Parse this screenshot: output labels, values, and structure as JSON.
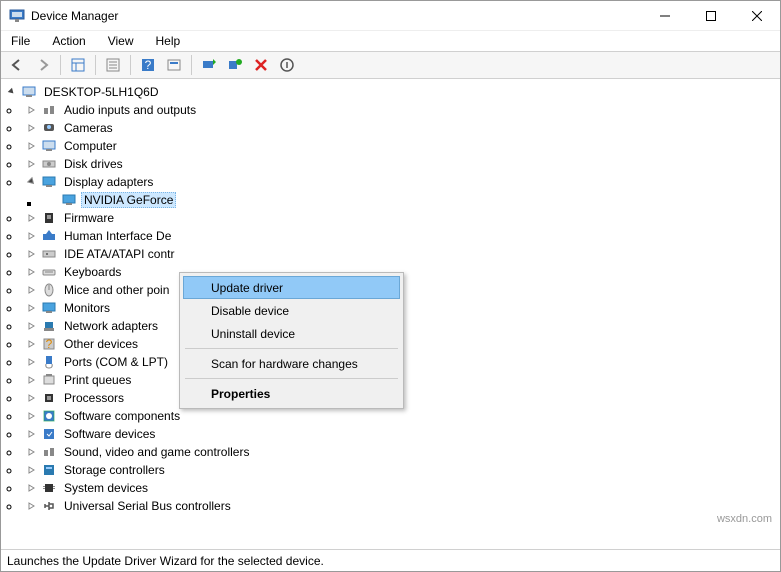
{
  "window": {
    "title": "Device Manager"
  },
  "menu": {
    "file": "File",
    "action": "Action",
    "view": "View",
    "help": "Help"
  },
  "tree": {
    "root": "DESKTOP-5LH1Q6D",
    "items": [
      "Audio inputs and outputs",
      "Cameras",
      "Computer",
      "Disk drives",
      "Display adapters",
      "Firmware",
      "Human Interface De",
      "IDE ATA/ATAPI contr",
      "Keyboards",
      "Mice and other poin",
      "Monitors",
      "Network adapters",
      "Other devices",
      "Ports (COM & LPT)",
      "Print queues",
      "Processors",
      "Software components",
      "Software devices",
      "Sound, video and game controllers",
      "Storage controllers",
      "System devices",
      "Universal Serial Bus controllers"
    ],
    "display_child": "NVIDIA GeForce"
  },
  "context": {
    "update": "Update driver",
    "disable": "Disable device",
    "uninstall": "Uninstall device",
    "scan": "Scan for hardware changes",
    "properties": "Properties"
  },
  "status": "Launches the Update Driver Wizard for the selected device.",
  "watermark": "wsxdn.com"
}
